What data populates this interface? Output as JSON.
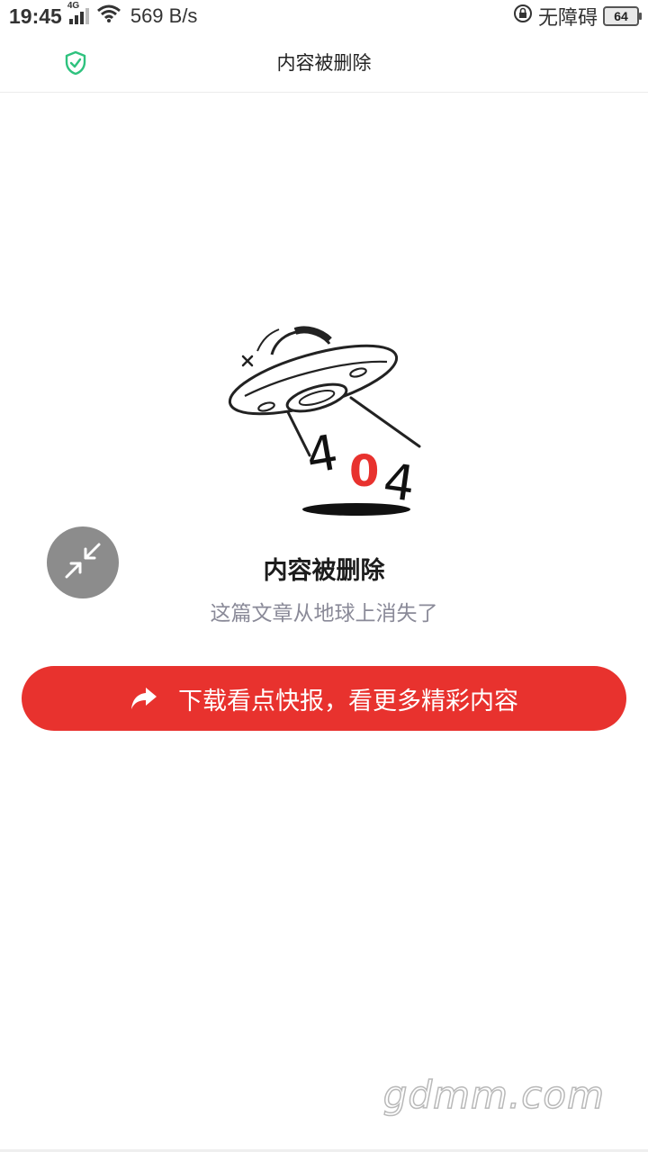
{
  "status_bar": {
    "time": "19:45",
    "network_type": "4G",
    "net_speed": "569 B/s",
    "accessibility_label": "无障碍",
    "battery_level": "64"
  },
  "header": {
    "title": "内容被删除"
  },
  "illustration": {
    "digit_left": "4",
    "digit_middle": "0",
    "digit_right": "4",
    "accent_color": "#e8322e"
  },
  "message": {
    "title": "内容被删除",
    "subtitle": "这篇文章从地球上消失了"
  },
  "cta": {
    "label": "下载看点快报，看更多精彩内容",
    "icon": "share-arrow-icon",
    "color": "#e8322e"
  },
  "watermark": {
    "text": "gdmm.com"
  }
}
